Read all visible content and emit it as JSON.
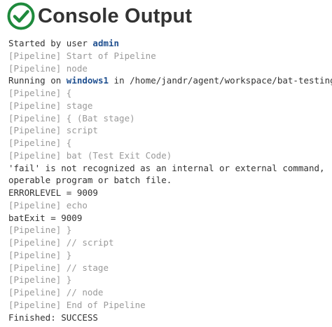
{
  "header": {
    "title": "Console Output",
    "status_icon": "success-check-icon",
    "status_color": "#1e8a3c"
  },
  "console": {
    "lines": [
      {
        "kind": "user",
        "pre": "Started by user ",
        "link": "admin",
        "post": ""
      },
      {
        "kind": "pipeline",
        "text": "[Pipeline] Start of Pipeline"
      },
      {
        "kind": "pipeline",
        "text": "[Pipeline] node"
      },
      {
        "kind": "node",
        "pre": "Running on ",
        "link": "windows1",
        "post": " in /home/jandr/agent/workspace/bat-testing"
      },
      {
        "kind": "pipeline",
        "text": "[Pipeline] {"
      },
      {
        "kind": "pipeline",
        "text": "[Pipeline] stage"
      },
      {
        "kind": "pipeline",
        "text": "[Pipeline] { (Bat stage)"
      },
      {
        "kind": "pipeline",
        "text": "[Pipeline] script"
      },
      {
        "kind": "pipeline",
        "text": "[Pipeline] {"
      },
      {
        "kind": "pipeline",
        "text": "[Pipeline] bat (Test Exit Code)"
      },
      {
        "kind": "output",
        "text": "'fail' is not recognized as an internal or external command,"
      },
      {
        "kind": "output",
        "text": "operable program or batch file."
      },
      {
        "kind": "output",
        "text": "ERRORLEVEL = 9009"
      },
      {
        "kind": "pipeline",
        "text": "[Pipeline] echo"
      },
      {
        "kind": "output",
        "text": "batExit = 9009"
      },
      {
        "kind": "pipeline",
        "text": "[Pipeline] }"
      },
      {
        "kind": "pipeline",
        "text": "[Pipeline] // script"
      },
      {
        "kind": "pipeline",
        "text": "[Pipeline] }"
      },
      {
        "kind": "pipeline",
        "text": "[Pipeline] // stage"
      },
      {
        "kind": "pipeline",
        "text": "[Pipeline] }"
      },
      {
        "kind": "pipeline",
        "text": "[Pipeline] // node"
      },
      {
        "kind": "pipeline",
        "text": "[Pipeline] End of Pipeline"
      },
      {
        "kind": "output",
        "text": "Finished: SUCCESS"
      }
    ]
  }
}
